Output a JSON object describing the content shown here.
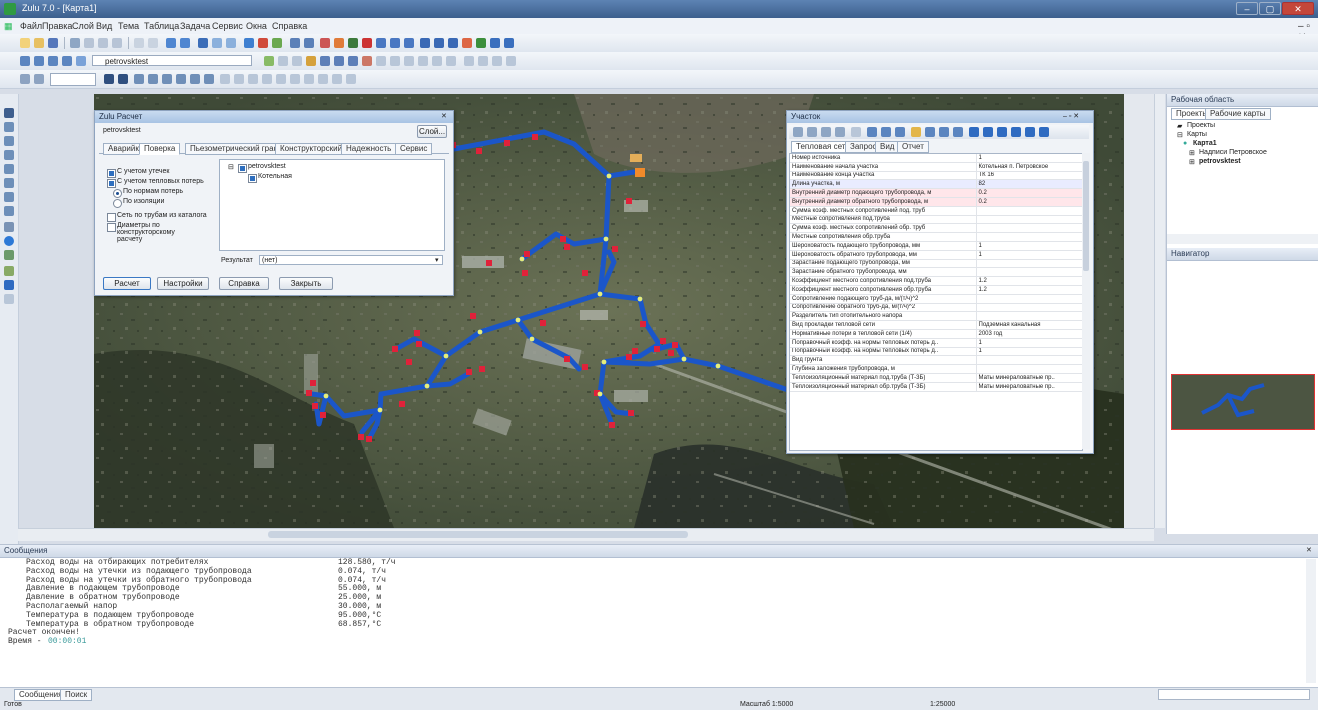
{
  "window": {
    "title": "Zulu 7.0 - [Карта1]",
    "minimize": "–",
    "restore": "▢",
    "close": "✕"
  },
  "menu": [
    "Файл",
    "Правка",
    "Слой",
    "Вид",
    "Тема",
    "Таблица",
    "Задача",
    "Сервис",
    "Окна",
    "Справка"
  ],
  "toolbar": {
    "layer_select": "petrovsktest"
  },
  "map_window": {
    "corner_label": "▭"
  },
  "calc_dialog": {
    "title": "Zulu Расчет",
    "layer": "petrovsktest",
    "select_btn": "Слой...",
    "tabs": [
      "Аварийка",
      "Поверка",
      "Пьезометрический график",
      "Конструкторский",
      "Надежность",
      "Сервис"
    ],
    "active_tab_index": 1,
    "options": [
      {
        "label": "С учетом утечек",
        "type": "checkbox",
        "checked": true
      },
      {
        "label": "С учетом тепловых потерь",
        "type": "checkbox",
        "checked": true
      },
      {
        "label": "По нормам потерь",
        "type": "radio",
        "checked": true
      },
      {
        "label": "По изоляции",
        "type": "radio",
        "checked": false
      },
      {
        "label": "Сеть по трубам из каталога",
        "type": "checkbox",
        "checked": false
      },
      {
        "label": "Диаметры по конструкторскому расчету",
        "type": "checkbox",
        "checked": false
      }
    ],
    "tree": {
      "root": "petrovsktest",
      "child": "Котельная"
    },
    "result_label": "Результат",
    "result_value": "(нет)",
    "buttons": {
      "calc": "Расчет",
      "settings": "Настройки",
      "help": "Справка",
      "close": "Закрыть"
    }
  },
  "props_window": {
    "title": "Участок",
    "tabs": [
      "Тепловая сеть",
      "Запрос",
      "Вид",
      "Отчет"
    ],
    "rows": [
      [
        "Номер источника",
        "1"
      ],
      [
        "Наименование начала участка",
        "Котельная п. Петровское"
      ],
      [
        "Наименование конца участка",
        "ТК 16"
      ],
      [
        "Длина участка, м",
        "82"
      ],
      [
        "Внутренний диаметр подающего трубопровода, м",
        "0.2"
      ],
      [
        "Внутренний диаметр обратного трубопровода, м",
        "0.2"
      ],
      [
        "Сумма коэф. местных сопротивлений под. труб",
        ""
      ],
      [
        "Местные сопротивления под.труба",
        ""
      ],
      [
        "Сумма коэф. местных сопротивлений обр. труб",
        ""
      ],
      [
        "Местные сопротивления обр.труба",
        ""
      ],
      [
        "Шероховатость подающего трубопровода, мм",
        "1"
      ],
      [
        "Шероховатость обратного трубопровода, мм",
        "1"
      ],
      [
        "Зарастание подающего трубопровода, мм",
        ""
      ],
      [
        "Зарастание обратного трубопровода, мм",
        ""
      ],
      [
        "Коэффициент местного сопротивления под.труба",
        "1.2"
      ],
      [
        "Коэффициент местного сопротивления обр.труба",
        "1.2"
      ],
      [
        "Сопротивление подающего труб-да, м/(т/ч)^2",
        ""
      ],
      [
        "Сопротивление обратного труб-да, м/(т/ч)^2",
        ""
      ],
      [
        "Разделитель тип отопительного напора",
        ""
      ],
      [
        "Вид прокладки тепловой сети",
        "Подземная канальная"
      ],
      [
        "Нормативные потери в тепловой сети (1/4)",
        "2003 год"
      ],
      [
        "Поправочный коэфф. на нормы тепловых потерь д..",
        "1"
      ],
      [
        "Поправочный коэфф. на нормы тепловых потерь д..",
        "1"
      ],
      [
        "Вид грунта",
        ""
      ],
      [
        "Глубина заложения трубопровода, м",
        ""
      ],
      [
        "Теплоизоляционный материал под.труба (Т-3Б)",
        "Маты минераловатные пр.."
      ],
      [
        "Теплоизоляционный материал обр.труба (Т-3Б)",
        "Маты минераловатные пр.."
      ]
    ]
  },
  "right_panel": {
    "title": "Рабочая область",
    "tabs": [
      "Проекты",
      "Рабочие карты"
    ],
    "tree": [
      "Проекты",
      "Карты",
      "Карта1",
      "Надписи Петровское",
      "petrovsktest"
    ],
    "overview_title": "Навигатор"
  },
  "messages": {
    "title": "Сообщения",
    "rows": [
      {
        "label": "Расход воды на отбирающих потребителях",
        "value": "128.580, т/ч"
      },
      {
        "label": "Расход воды на утечки из подающего трубопровода",
        "value": "0.074, т/ч"
      },
      {
        "label": "Расход воды на утечки из обратного трубопровода",
        "value": "0.074, т/ч"
      },
      {
        "label": "Давление в подающем трубопроводе",
        "value": "55.000, м"
      },
      {
        "label": "Давление в обратном трубопроводе",
        "value": "25.000, м"
      },
      {
        "label": "Располагаемый напор",
        "value": "30.000, м"
      },
      {
        "label": "Температура в подающем трубопроводе",
        "value": "95.000,°C"
      },
      {
        "label": "Температура в обратном трубопроводе",
        "value": "68.857,°C"
      }
    ],
    "footer1": "Расчет окончен!",
    "footer2_label": "Время - ",
    "footer2_value": "00:00:01"
  },
  "bottom_tabs": [
    "Сообщения",
    "Поиск"
  ],
  "status": {
    "left": "Готов",
    "mid1": "Масштаб 1:5000",
    "mid2": "1:25000"
  },
  "colors": {
    "pipe": "#1b56c9",
    "consumer": "#e0223a",
    "node": "#e6ee7a",
    "source": "#f08a2a"
  }
}
